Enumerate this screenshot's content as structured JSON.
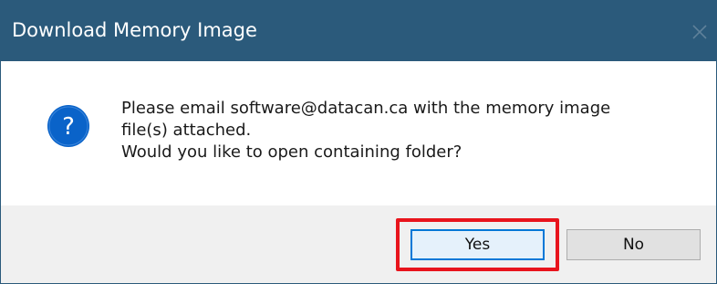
{
  "dialog": {
    "title": "Download Memory Image",
    "message_lines": [
      "Please email software@datacan.ca with the memory image",
      "file(s) attached.",
      "Would you like to open containing folder?"
    ],
    "icon": "question-icon",
    "buttons": {
      "yes_label": "Yes",
      "no_label": "No"
    }
  },
  "colors": {
    "titlebar": "#2b5a7b",
    "icon_blue": "#0a63c9",
    "default_button_border": "#0078d7",
    "highlight": "#e8141c",
    "footer": "#f0f0f0"
  }
}
